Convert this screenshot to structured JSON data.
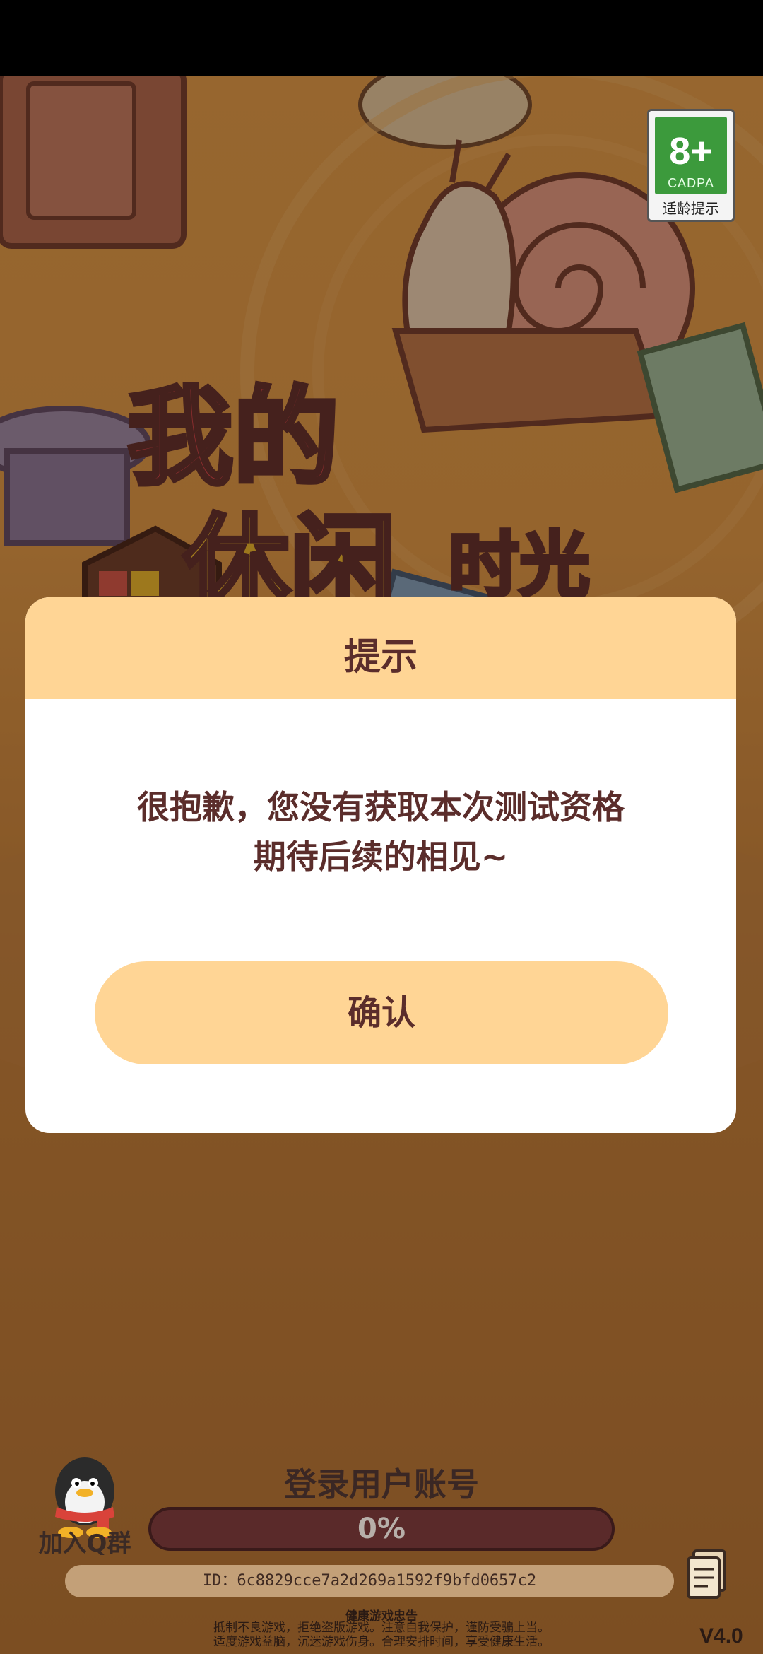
{
  "age_badge": {
    "number": "8+",
    "org": "CADPA",
    "label": "适龄提示"
  },
  "logo": {
    "line1": "我的",
    "line2": "休闲",
    "line3": "时光"
  },
  "dialog": {
    "title": "提示",
    "message_line1": "很抱歉，您没有获取本次测试资格",
    "message_line2": "期待后续的相见~",
    "confirm_label": "确认"
  },
  "qq_group": {
    "label": "加入Q群"
  },
  "login": {
    "label": "登录用户账号",
    "progress_percent": 0,
    "progress_text": "0%"
  },
  "account_id": "ID：6c8829cce7a2d269a1592f9bfd0657c2",
  "health_advice": {
    "title": "健康游戏忠告",
    "line1": "抵制不良游戏，拒绝盗版游戏。注意自我保护，谨防受骗上当。",
    "line2": "适度游戏益脑，沉迷游戏伤身。合理安排时间，享受健康生活。"
  },
  "version": "V4.0",
  "colors": {
    "dialog_header": "#ffd595",
    "text_dark": "#5b2d2b",
    "background": "#e39f48"
  }
}
